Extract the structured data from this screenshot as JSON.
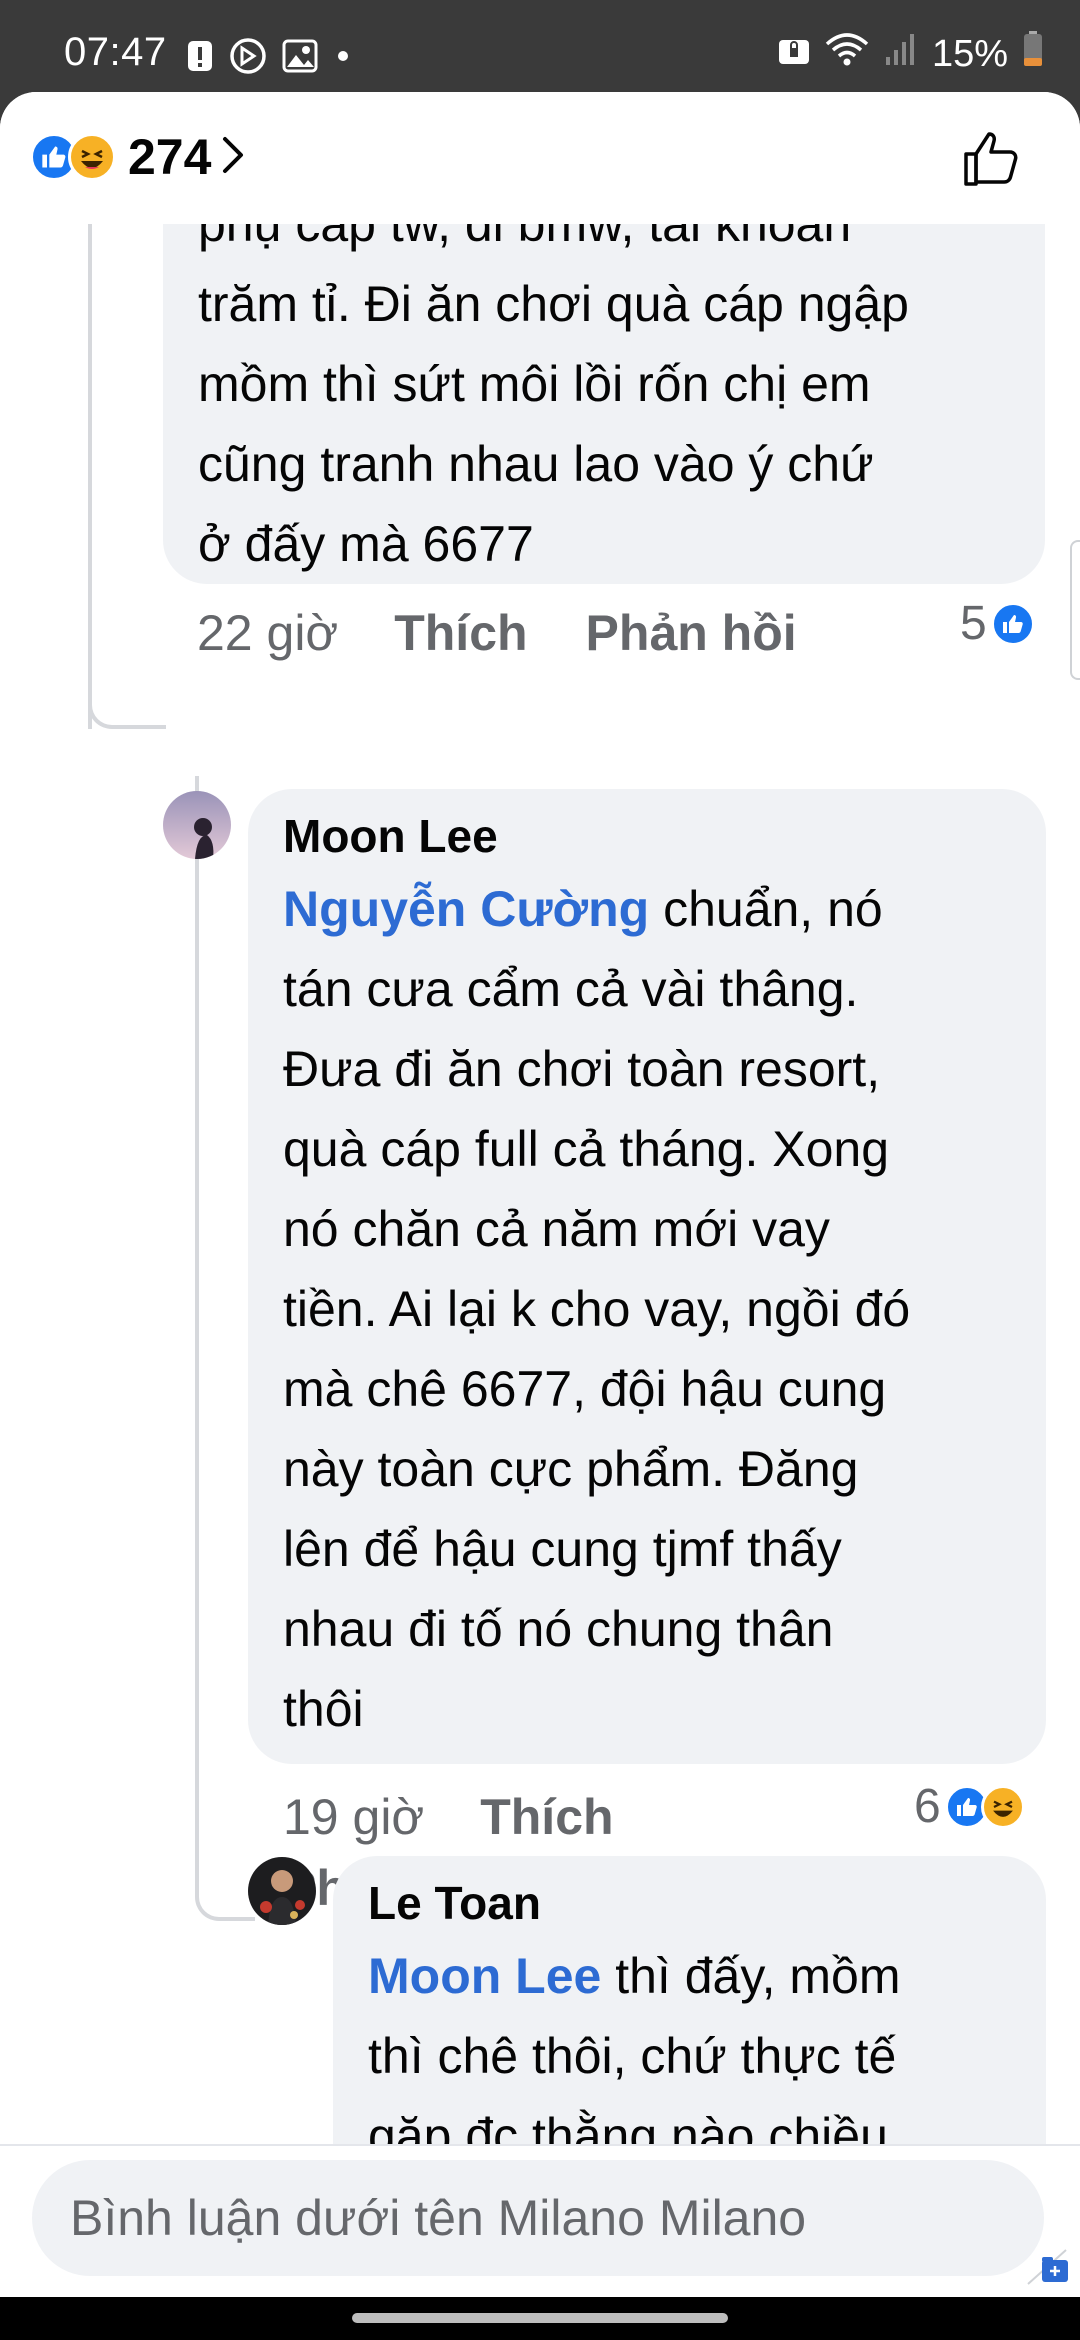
{
  "status_bar": {
    "time": "07:47",
    "battery": "15%",
    "left_icons": [
      "alert-icon",
      "timer-icon",
      "image-icon",
      "dot-icon"
    ],
    "right_icons": [
      "lock-icon",
      "wifi-icon",
      "signal-icon",
      "battery-icon"
    ]
  },
  "header": {
    "reactions": [
      "like",
      "haha"
    ],
    "reaction_count": "274"
  },
  "comments": [
    {
      "partial_top_line": "phụ cấp tw, đi bmw, tài khoản",
      "lines": [
        "trăm tỉ. Đi ăn chơi quà cáp ngập",
        "mồm thì sứt môi lồi rốn chị em",
        "cũng tranh nhau lao vào ý chứ",
        "ở đấy mà 6677"
      ],
      "time": "22 giờ",
      "like_label": "Thích",
      "reply_label": "Phản hồi",
      "reaction_count": "5"
    },
    {
      "author": "Moon Lee",
      "mention": "Nguyễn Cường",
      "first_line_rest": " chuẩn, nó",
      "lines": [
        "tán cưa cẩm cả vài thâng.",
        "Đưa đi ăn chơi toàn resort,",
        "quà cáp full cả tháng. Xong",
        "nó chăn cả năm mới vay",
        "tiền. Ai lại k cho vay, ngồi đó",
        "mà chê 6677, đội hậu cung",
        "này toàn cực phẩm. Đăng",
        "lên để hậu cung tjmf thấy",
        "nhau đi tố nó chung thân",
        "thôi"
      ],
      "time": "19 giờ",
      "like_label": "Thích",
      "reply_label": "Phản hồi",
      "reaction_count": "6"
    },
    {
      "author": "Le Toan",
      "mention": "Moon Lee",
      "first_line_rest": " thì đấy, mồm",
      "lines": [
        "thì chê thôi, chứ thực tế",
        "gặp đc thằng nào chiều"
      ]
    }
  ],
  "composer": {
    "placeholder": "Bình luận dưới tên Milano Milano"
  },
  "colors": {
    "mention": "#2d6bd3",
    "like_blue": "#1877f2",
    "haha_yellow": "#f7b125",
    "bubble_bg": "#f0f2f5",
    "meta_gray": "#65676b"
  }
}
